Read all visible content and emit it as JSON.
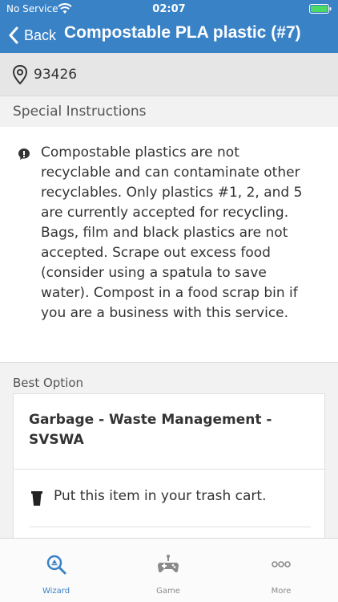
{
  "status": {
    "carrier": "No Service",
    "time": "02:07"
  },
  "nav": {
    "back_label": "Back",
    "title": "Compostable PLA plastic (#7)"
  },
  "location": {
    "zip": "93426"
  },
  "instructions": {
    "header": "Special Instructions",
    "text": "Compostable plastics are not recyclable and can contaminate other recyclables. Only plastics #1, 2, and 5 are currently accepted for recycling. Bags, film and black plastics are not accepted. Scrape out excess food (consider using a spatula to save water). Compost in a food scrap bin if you are a business with this service."
  },
  "best_option": {
    "header": "Best Option",
    "title": "Garbage - Waste Management - SVSWA",
    "action": "Put this item in your trash cart."
  },
  "tabs": [
    {
      "label": "Wizard",
      "icon": "recycle-search-icon",
      "active": true
    },
    {
      "label": "Game",
      "icon": "gamepad-icon",
      "active": false
    },
    {
      "label": "More",
      "icon": "more-dots-icon",
      "active": false
    }
  ],
  "colors": {
    "brand_blue": "#3a82c6",
    "battery_green": "#4cd964"
  }
}
